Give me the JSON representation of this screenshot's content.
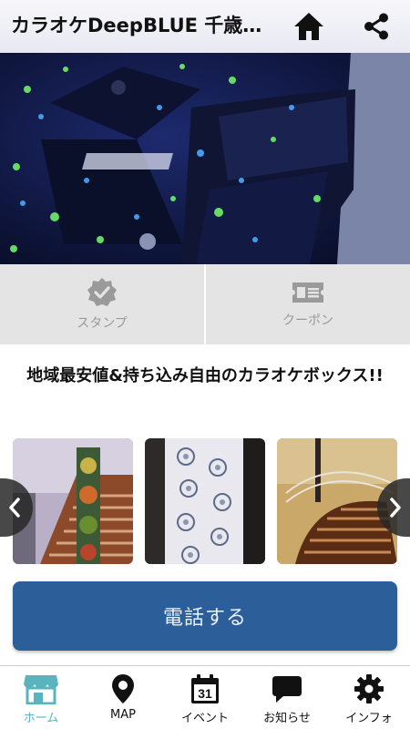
{
  "header": {
    "title": "カラオケDeepBLUE 千歳…",
    "home_icon": "home-icon",
    "share_icon": "share-icon"
  },
  "hero": {
    "image": "karaoke-room-photo"
  },
  "grid": {
    "items": [
      {
        "label": "スタンプ",
        "icon": "stamp-check-icon"
      },
      {
        "label": "クーポン",
        "icon": "coupon-icon"
      }
    ]
  },
  "headline": "地域最安値&持ち込み自由のカラオケボックス!!",
  "gallery": {
    "images": [
      "stairs-totem-photo",
      "patterned-wall-photo",
      "spiral-stairs-photo"
    ],
    "prev_icon": "chevron-left-icon",
    "next_icon": "chevron-right-icon"
  },
  "call_button": "電話する",
  "tabbar": {
    "active_color": "#5ab4c0",
    "items": [
      {
        "label": "ホーム",
        "icon": "store-icon",
        "active": true
      },
      {
        "label": "MAP",
        "icon": "map-pin-icon"
      },
      {
        "label": "イベント",
        "icon": "calendar-icon",
        "badge": "31"
      },
      {
        "label": "お知らせ",
        "icon": "chat-bubble-icon"
      },
      {
        "label": "インフォ",
        "icon": "gear-icon"
      }
    ]
  },
  "colors": {
    "primary": "#2c5f9a",
    "grid_bg": "#e4e4e4",
    "icon_grey": "#9a9a9a"
  }
}
